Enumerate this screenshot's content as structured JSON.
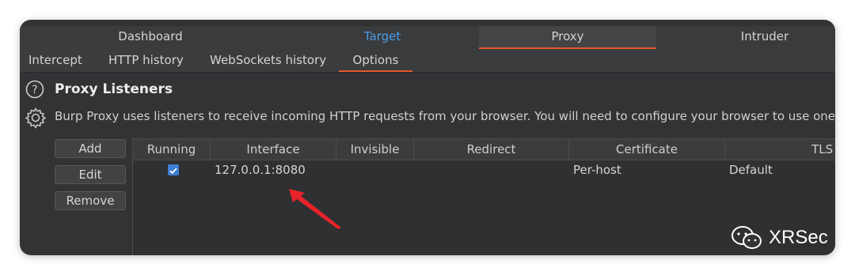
{
  "main_tabs": [
    "Dashboard",
    "Target",
    "Proxy",
    "Intruder"
  ],
  "sub_tabs": [
    "Intercept",
    "HTTP history",
    "WebSockets history",
    "Options"
  ],
  "section": {
    "title": "Proxy Listeners",
    "description": "Burp Proxy uses listeners to receive incoming HTTP requests from your browser. You will need to configure your browser to use one of"
  },
  "buttons": {
    "add": "Add",
    "edit": "Edit",
    "remove": "Remove"
  },
  "table": {
    "columns": [
      "Running",
      "Interface",
      "Invisible",
      "Redirect",
      "Certificate",
      "TLS P"
    ],
    "rows": [
      {
        "running": true,
        "interface": "127.0.0.1:8080",
        "invisible": "",
        "redirect": "",
        "certificate": "Per-host",
        "tls": "Default"
      }
    ]
  },
  "watermark": {
    "text": "XRSec"
  },
  "colors": {
    "accent": "#e55a2b",
    "target_tab": "#4d9be6",
    "arrow": "#e8242a",
    "checkbox": "#3d7fd6"
  }
}
